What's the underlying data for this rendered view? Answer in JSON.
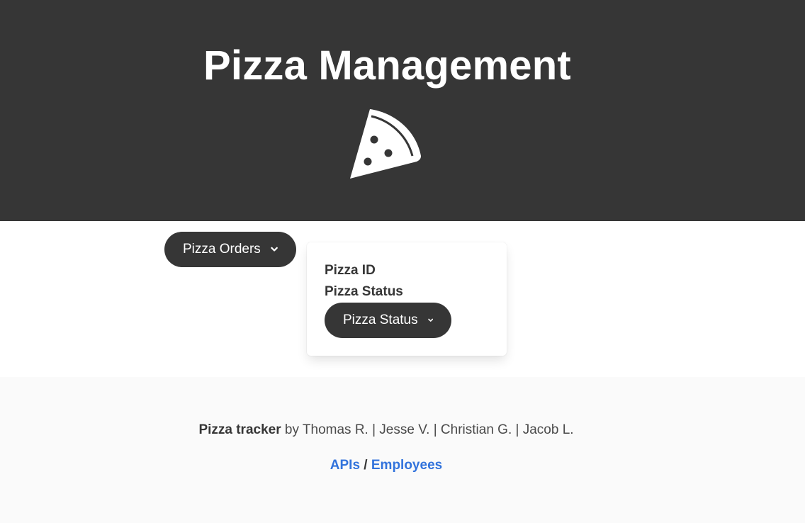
{
  "hero": {
    "title": "Pizza Management",
    "icon": "pizza-slice-icon"
  },
  "orders_dropdown": {
    "label": "Pizza Orders",
    "icon": "chevron-down-icon"
  },
  "card": {
    "pizza_id_label": "Pizza ID",
    "pizza_status_label": "Pizza Status",
    "status_dropdown": {
      "label": "Pizza Status",
      "icon": "chevron-down-icon"
    }
  },
  "footer": {
    "app_name": "Pizza tracker",
    "credits": " by Thomas R. | Jesse V. | Christian G. | Jacob L.",
    "links": [
      {
        "label": "APIs"
      },
      {
        "label": "Employees"
      }
    ],
    "separator": " / "
  },
  "colors": {
    "dark": "#363636",
    "link": "#3273dc",
    "footer_bg": "#fafafa"
  }
}
